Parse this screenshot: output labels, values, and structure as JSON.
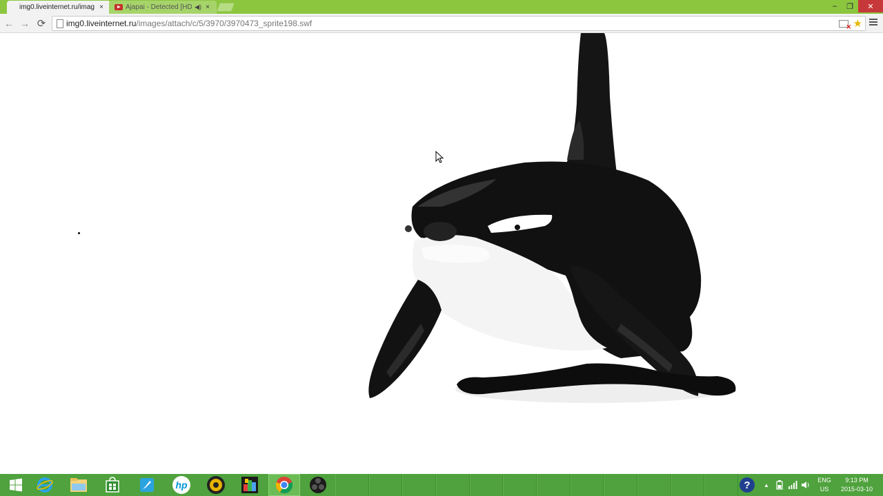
{
  "browser": {
    "tabs": [
      {
        "title": "img0.liveinternet.ru/imag",
        "close": "×",
        "active": true
      },
      {
        "title": "Ajapai - Detected [HD]",
        "close": "×",
        "active": false,
        "icon": "youtube-icon",
        "audio_icon": "speaker-icon"
      }
    ],
    "window_controls": {
      "minimize": "–",
      "maximize": "❐",
      "close": "✕"
    },
    "nav": {
      "back": "←",
      "forward": "→",
      "reload": "⟳"
    },
    "address": {
      "host": "img0.liveinternet.ru",
      "path": "/images/attach/c/5/3970/3970473_sprite198.swf"
    },
    "star": "★"
  },
  "content": {
    "description_icons": [
      "orca-illustration",
      "mouse-pointer-icon"
    ]
  },
  "taskbar": {
    "pinned": [
      "windows-start-icon",
      "internet-explorer-icon",
      "file-explorer-icon",
      "store-icon",
      "rocket-icon",
      "hp-icon",
      "media-player-icon",
      "photo-app-icon",
      "chrome-icon",
      "obs-icon"
    ],
    "hp_label": "hp",
    "help_label": "?",
    "language": {
      "line1": "ENG",
      "line2": "US"
    },
    "time": "9:13 PM",
    "date": "2015-03-10",
    "tray_arrow": "▲"
  },
  "colors": {
    "chrome_frame": "#8cc63f",
    "taskbar": "#4fa23d",
    "close_button": "#c7383a"
  }
}
